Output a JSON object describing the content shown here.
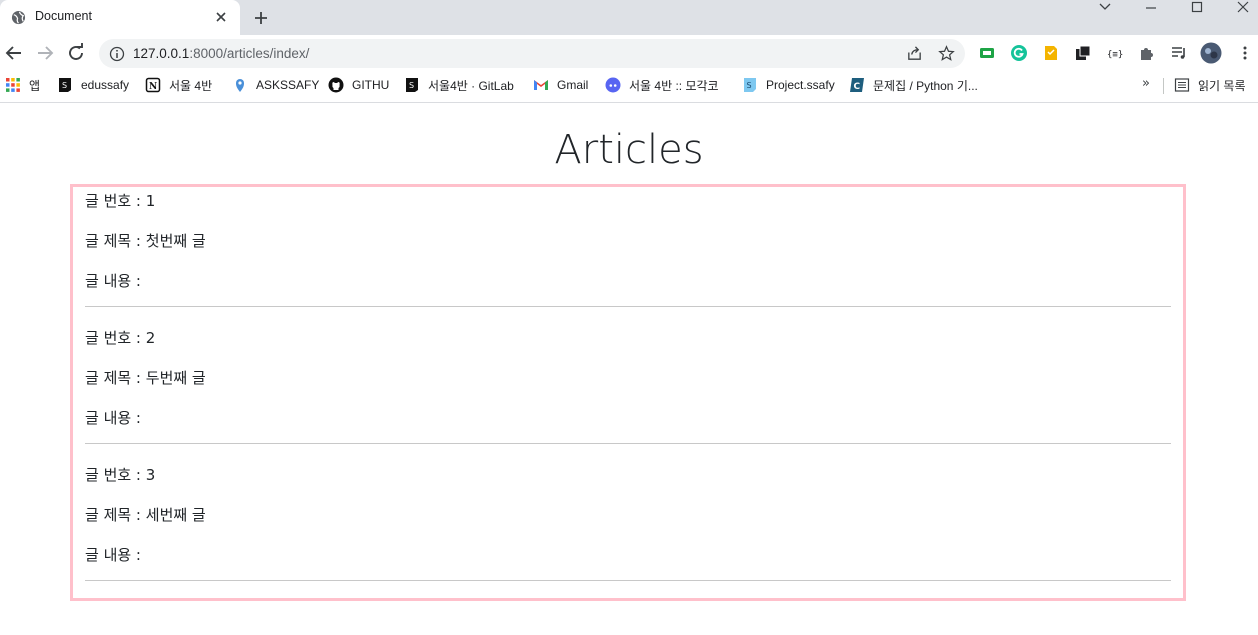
{
  "browser": {
    "tab_title": "Document",
    "url_host": "127.0.0.1",
    "url_rest": ":8000/articles/index/"
  },
  "bookmarks": [
    {
      "label": "앱",
      "icon": "apps-grid-icon"
    },
    {
      "label": "edussafy",
      "icon": "ssafy-icon"
    },
    {
      "label": "서울 4반",
      "icon": "notion-icon"
    },
    {
      "label": "ASKSSAFY",
      "icon": "pin-icon"
    },
    {
      "label": "GITHU",
      "icon": "github-icon"
    },
    {
      "label": "서울4반 · GitLab",
      "icon": "ssafy-icon"
    },
    {
      "label": "Gmail",
      "icon": "gmail-icon"
    },
    {
      "label": "서울 4반 :: 모각코",
      "icon": "discord-icon"
    },
    {
      "label": "Project.ssafy",
      "icon": "project-icon"
    },
    {
      "label": "문제집 / Python 기...",
      "icon": "codeup-icon"
    }
  ],
  "bookmarks_more": "»",
  "reading_list": "읽기 목록",
  "page": {
    "title": "Articles",
    "labels": {
      "number": "글 번호 : ",
      "title": "글 제목 : ",
      "content": "글 내용 : "
    },
    "articles": [
      {
        "number": "1",
        "title": "첫번째 글",
        "content": ""
      },
      {
        "number": "2",
        "title": "두번째 글",
        "content": ""
      },
      {
        "number": "3",
        "title": "세번째 글",
        "content": ""
      }
    ]
  },
  "colors": {
    "box_border": "#ffc0cb",
    "tabstrip": "#dee1e6",
    "omnibox": "#f1f3f4"
  }
}
